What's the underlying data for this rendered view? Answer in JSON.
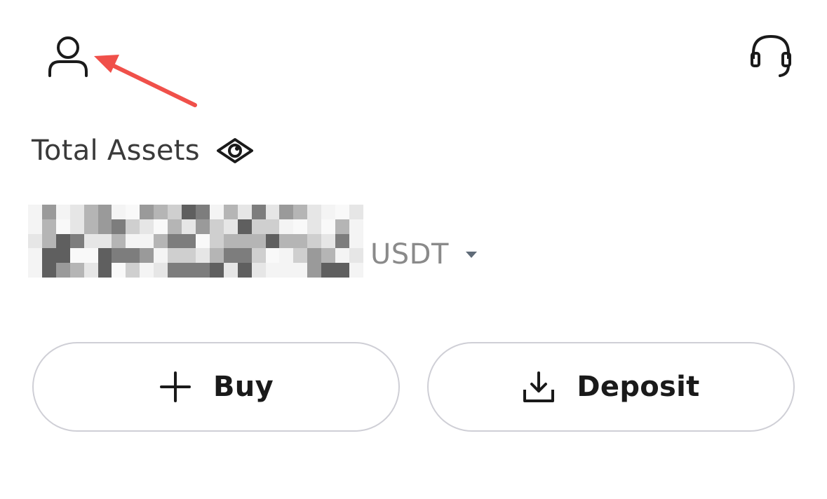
{
  "header": {
    "profile_icon": "user-icon",
    "support_icon": "headset-icon"
  },
  "assets": {
    "label": "Total Assets",
    "visibility_icon": "eye-icon",
    "balance_display": "obscured",
    "currency": "USDT",
    "currency_dropdown_icon": "caret-down-icon"
  },
  "actions": {
    "buy": {
      "label": "Buy",
      "icon": "plus-icon"
    },
    "deposit": {
      "label": "Deposit",
      "icon": "download-icon"
    }
  },
  "annotation": {
    "type": "arrow",
    "target": "profile-button",
    "color": "#f0504a"
  },
  "colors": {
    "background": "#ffffff",
    "text_primary": "#1a1a1a",
    "text_secondary": "#8a8a8a",
    "button_border": "#cfcfd6",
    "annotation": "#f0504a"
  }
}
